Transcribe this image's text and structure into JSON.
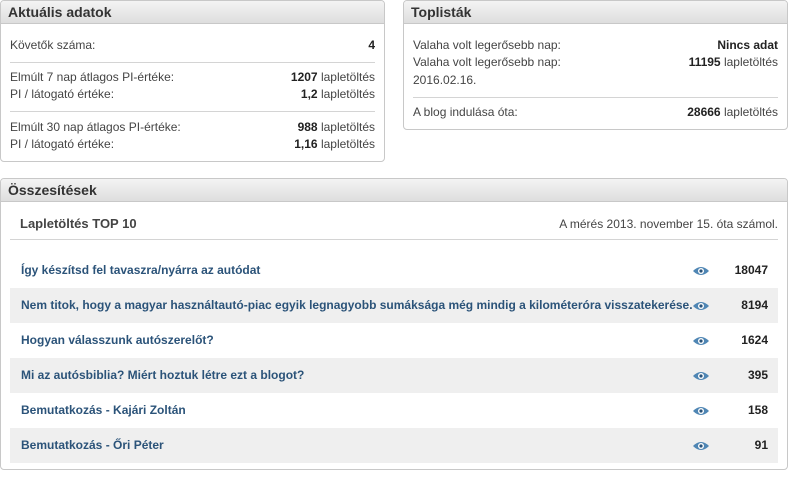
{
  "current": {
    "title": "Aktuális adatok",
    "followers_label": "Követők száma:",
    "followers_value": "4",
    "unit": "lapletöltés",
    "avg7_label": "Elmúlt 7 nap átlagos PI-értéke:",
    "avg7_value": "1207",
    "pi7_label": "PI / látogató értéke:",
    "pi7_value": "1,2",
    "avg30_label": "Elmúlt 30 nap átlagos PI-értéke:",
    "avg30_value": "988",
    "pi30_label": "PI / látogató értéke:",
    "pi30_value": "1,16"
  },
  "top": {
    "title": "Toplisták",
    "best_day_label": "Valaha volt legerősebb nap:",
    "best_day_value": "Nincs adat",
    "best_day2_label": "Valaha volt legerősebb nap:",
    "best_day2_value": "11195",
    "best_day2_unit": "lapletöltés",
    "best_day2_date": "2016.02.16.",
    "since_start_label": "A blog indulása óta:",
    "since_start_value": "28666",
    "since_start_unit": "lapletöltés"
  },
  "summary": {
    "title": "Összesítések",
    "subtitle": "Lapletöltés TOP 10",
    "note": "A mérés 2013. november 15. óta számol.",
    "icon": "eye-icon",
    "accent": "#2b5379",
    "items": [
      {
        "title": "Így készítsd fel tavaszra/nyárra az autódat",
        "count": "18047"
      },
      {
        "title": "Nem titok, hogy a magyar használtautó-piac egyik legnagyobb sumáksága még mindig a kilométeróra visszatekerése.",
        "count": "8194"
      },
      {
        "title": "Hogyan válasszunk autószerelőt?",
        "count": "1624"
      },
      {
        "title": "Mi az autósbiblia? Miért hoztuk létre ezt a blogot?",
        "count": "395"
      },
      {
        "title": "Bemutatkozás - Kajári Zoltán",
        "count": "158"
      },
      {
        "title": "Bemutatkozás - Őri Péter",
        "count": "91"
      }
    ]
  }
}
